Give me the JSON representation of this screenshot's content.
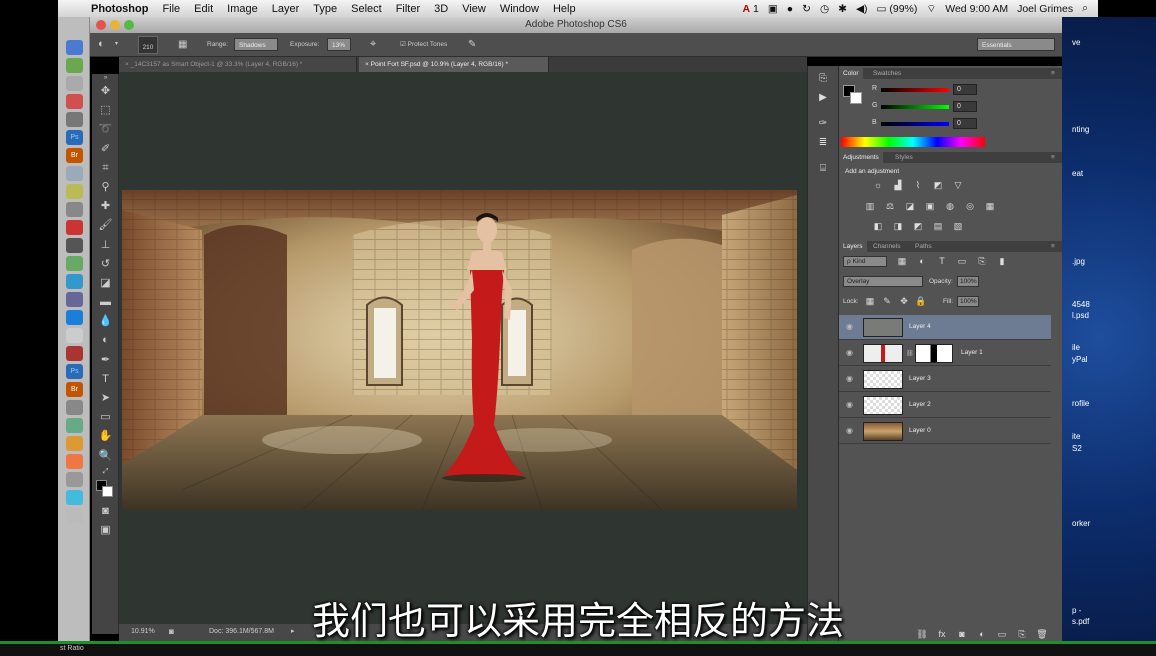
{
  "menubar": {
    "apple": "",
    "items": [
      "Photoshop",
      "File",
      "Edit",
      "Image",
      "Layer",
      "Type",
      "Select",
      "Filter",
      "3D",
      "View",
      "Window",
      "Help"
    ],
    "status": {
      "adobe_count": "1",
      "battery": "(99%)",
      "clock": "Wed 9:00 AM",
      "user": "Joel Grimes"
    }
  },
  "window": {
    "title": "Adobe Photoshop CS6"
  },
  "options": {
    "brush_size": "210",
    "range_label": "Range:",
    "range_value": "Shadows",
    "exposure_label": "Exposure:",
    "exposure_value": "13%",
    "protect_label": "Protect Tones",
    "workspace": "Essentials"
  },
  "tabs": [
    {
      "label": "_14C3157 as Smart Object-1 @ 33.3% (Layer 4, RGB/16) *",
      "active": false
    },
    {
      "label": "Point Fort SF.psd @ 10.9% (Layer 4, RGB/16) *",
      "active": true
    }
  ],
  "status": {
    "zoom": "10.91%",
    "doc": "Doc: 396.1M/567.8M"
  },
  "color_panel": {
    "tabs": [
      "Color",
      "Swatches"
    ],
    "r_label": "R",
    "r_value": "0",
    "g_label": "G",
    "g_value": "0",
    "b_label": "B",
    "b_value": "0"
  },
  "adjustments_panel": {
    "tabs": [
      "Adjustments",
      "Styles"
    ],
    "heading": "Add an adjustment"
  },
  "layers_panel": {
    "tabs": [
      "Layers",
      "Channels",
      "Paths"
    ],
    "filter_kind": "ρ Kind",
    "blend_mode": "Overlay",
    "opacity_label": "Opacity:",
    "opacity_value": "100%",
    "lock_label": "Lock:",
    "fill_label": "Fill:",
    "fill_value": "100%",
    "layers": [
      {
        "name": "Layer 4",
        "selected": true
      },
      {
        "name": "Layer 1",
        "selected": false
      },
      {
        "name": "Layer 3",
        "selected": false
      },
      {
        "name": "Layer 2",
        "selected": false
      },
      {
        "name": "Layer 0",
        "selected": false
      }
    ]
  },
  "desktop_labels": [
    "ve",
    "nting",
    "eat",
    ".jpg",
    "4548",
    "l.psd",
    "ile",
    "yPal",
    "rofile",
    "ite",
    "S2",
    "orker",
    "p -",
    "s.pdf"
  ],
  "bottom_left_label": "st Ratio",
  "subtitle": "我们也可以采用完全相反的方法",
  "colors": {
    "accent_selected_layer": "#6d7c93",
    "dress_red": "#c41a1a",
    "desktop_blue": "#123a80"
  }
}
